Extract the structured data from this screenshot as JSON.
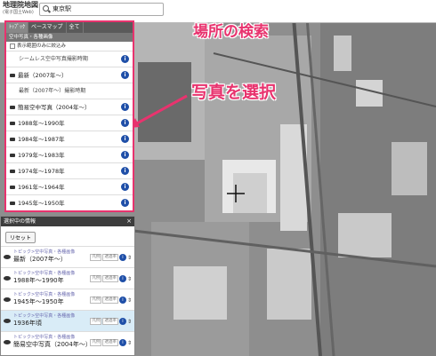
{
  "topbar": {
    "logo_title": "地理院地図",
    "logo_sub": "(電子国土Web)",
    "search_value": "東京駅"
  },
  "panel": {
    "tabs": [
      "ﾄｯﾌﾟｯｸ",
      "ベースマップ",
      "全て"
    ],
    "subheader": "空中写真・各種画像",
    "checkbox_label": "表示範囲のみに絞込み",
    "rows": [
      {
        "label": "シームレス空中写真撮影時期",
        "sub": true,
        "info": true
      },
      {
        "label": "最新（2007年〜）",
        "sub": false,
        "info": true
      },
      {
        "label": "最新（2007年〜）撮影時期",
        "sub": true,
        "info": false
      },
      {
        "label": "簡易空中写真（2004年〜）",
        "sub": false,
        "info": true
      },
      {
        "label": "1988年〜1990年",
        "sub": false,
        "info": true
      },
      {
        "label": "1984年〜1987年",
        "sub": false,
        "info": true
      },
      {
        "label": "1979年〜1983年",
        "sub": false,
        "info": true
      },
      {
        "label": "1974年〜1978年",
        "sub": false,
        "info": true
      },
      {
        "label": "1961年〜1964年",
        "sub": false,
        "info": true
      },
      {
        "label": "1945年〜1950年",
        "sub": false,
        "info": true
      }
    ]
  },
  "selected": {
    "title": "選択中の情報",
    "close": "×",
    "reset_label": "リセット",
    "layers": [
      {
        "category": "トピック>空中写真・各種画像",
        "name": "最新（2007年〜）",
        "highlight": false
      },
      {
        "category": "トピック>空中写真・各種画像",
        "name": "1988年〜1990年",
        "highlight": false
      },
      {
        "category": "トピック>空中写真・各種画像",
        "name": "1945年〜1950年",
        "highlight": false
      },
      {
        "category": "トピック>空中写真・各種画像",
        "name": "1936年頃",
        "highlight": true
      },
      {
        "category": "トピック>空中写真・各種画像",
        "name": "簡易空中写真（2004年〜）",
        "highlight": false
      }
    ],
    "btn_a": "凡例",
    "btn_b": "透過率"
  },
  "annotations": {
    "search": "場所の検索",
    "select": "写真を選択",
    "color": "#e8336e"
  }
}
